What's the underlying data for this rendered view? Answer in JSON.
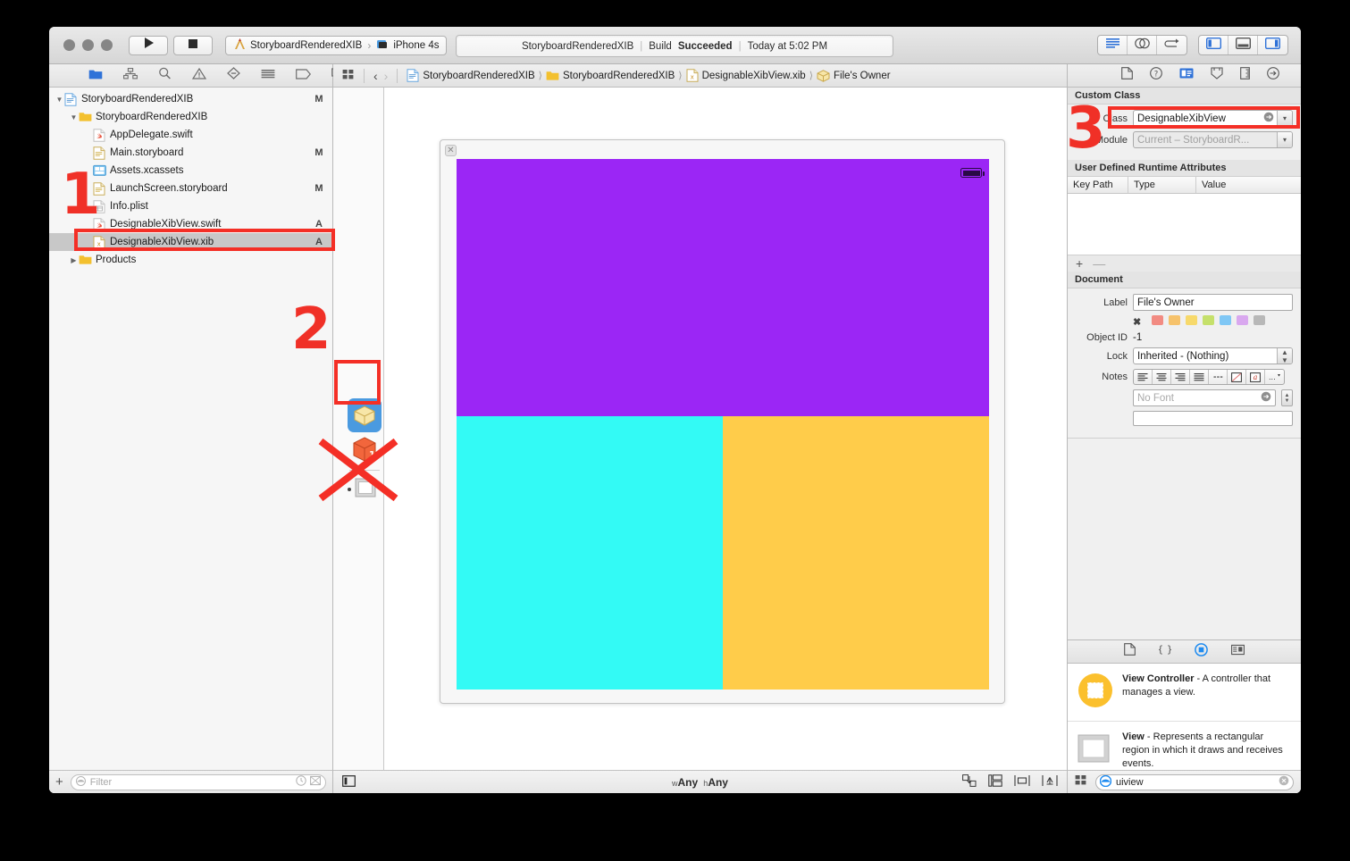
{
  "window": {
    "traffic_lights": [
      "close",
      "minimize",
      "zoom"
    ],
    "run_button": "run-icon",
    "stop_button": "stop-icon",
    "scheme": {
      "project": "StoryboardRenderedXIB",
      "destination": "iPhone 4s"
    },
    "status": {
      "project": "StoryboardRenderedXIB",
      "build_label": "Build",
      "build_result": "Succeeded",
      "time": "Today at 5:02 PM"
    },
    "editor_segment": [
      "standard-editor-icon",
      "assistant-editor-icon",
      "version-editor-icon"
    ],
    "view_segment": [
      "navigator-toggle-icon",
      "debug-area-toggle-icon",
      "utilities-toggle-icon"
    ]
  },
  "navigator": {
    "tabs": [
      "project-navigator-icon",
      "symbol-navigator-icon",
      "find-navigator-icon",
      "issue-navigator-icon",
      "test-navigator-icon",
      "debug-navigator-icon",
      "breakpoint-navigator-icon",
      "report-navigator-icon"
    ],
    "tree": [
      {
        "label": "StoryboardRenderedXIB",
        "badge": "M",
        "indent": 0,
        "icon": "project-icon",
        "disclosure": "open",
        "selected": false
      },
      {
        "label": "StoryboardRenderedXIB",
        "badge": "",
        "indent": 1,
        "icon": "folder-icon",
        "disclosure": "open",
        "selected": false
      },
      {
        "label": "AppDelegate.swift",
        "badge": "",
        "indent": 2,
        "icon": "swift-file-icon",
        "disclosure": "",
        "selected": false
      },
      {
        "label": "Main.storyboard",
        "badge": "M",
        "indent": 2,
        "icon": "storyboard-file-icon",
        "disclosure": "",
        "selected": false
      },
      {
        "label": "Assets.xcassets",
        "badge": "",
        "indent": 2,
        "icon": "assets-icon",
        "disclosure": "",
        "selected": false
      },
      {
        "label": "LaunchScreen.storyboard",
        "badge": "M",
        "indent": 2,
        "icon": "storyboard-file-icon",
        "disclosure": "",
        "selected": false
      },
      {
        "label": "Info.plist",
        "badge": "",
        "indent": 2,
        "icon": "plist-file-icon",
        "disclosure": "",
        "selected": false
      },
      {
        "label": "DesignableXibView.swift",
        "badge": "A",
        "indent": 2,
        "icon": "swift-file-icon",
        "disclosure": "",
        "selected": false
      },
      {
        "label": "DesignableXibView.xib",
        "badge": "A",
        "indent": 2,
        "icon": "xib-file-icon",
        "disclosure": "",
        "selected": true
      },
      {
        "label": "Products",
        "badge": "",
        "indent": 1,
        "icon": "folder-icon",
        "disclosure": "closed",
        "selected": false
      }
    ],
    "filter": {
      "placeholder": "Filter",
      "add_label": "+"
    }
  },
  "editor": {
    "breadcrumb": [
      {
        "label": "StoryboardRenderedXIB",
        "icon": "project-icon"
      },
      {
        "label": "StoryboardRenderedXIB",
        "icon": "folder-icon"
      },
      {
        "label": "DesignableXibView.xib",
        "icon": "xib-file-icon"
      },
      {
        "label": "File's Owner",
        "icon": "files-owner-icon"
      }
    ],
    "dock": [
      {
        "name": "files-owner-icon",
        "selected": true
      },
      {
        "name": "first-responder-icon",
        "selected": false
      },
      {
        "name": "view-object-icon",
        "selected": false,
        "crossed_out": true
      }
    ],
    "canvas": {
      "view_background_colors": {
        "top": "#9B26F5",
        "bottom_left": "#33FAF5",
        "bottom_right": "#FFCC4A"
      },
      "status_bar_item": "battery-icon"
    },
    "bottom_bar": {
      "left_icon": "show-document-outline-icon",
      "size_class": {
        "w_prefix": "w",
        "w_value": "Any",
        "h_prefix": "h",
        "h_value": "Any"
      },
      "right_icons": [
        "update-frames-icon",
        "embed-in-icon",
        "align-icon",
        "resolve-autolayout-icon"
      ]
    }
  },
  "inspector": {
    "tabs": [
      "file-inspector-icon",
      "quick-help-icon",
      "identity-inspector-icon",
      "attributes-inspector-icon",
      "size-inspector-icon",
      "connections-inspector-icon"
    ],
    "custom_class": {
      "title": "Custom Class",
      "class_label": "Class",
      "class_value": "DesignableXibView",
      "module_label": "Module",
      "module_value": "Current – StoryboardR..."
    },
    "runtime_attributes": {
      "title": "User Defined Runtime Attributes",
      "columns": [
        "Key Path",
        "Type",
        "Value"
      ],
      "rows": [],
      "add_label": "+",
      "remove_label": "—"
    },
    "document": {
      "title": "Document",
      "label_label": "Label",
      "label_value": "File's Owner",
      "label_colors": [
        "#f28b82",
        "#f6c26b",
        "#f7d96b",
        "#c5e06b",
        "#7fc7f5",
        "#d9a8ef",
        "#b8b8b8"
      ],
      "object_id_label": "Object ID",
      "object_id_value": "-1",
      "lock_label": "Lock",
      "lock_value": "Inherited - (Nothing)",
      "notes_label": "Notes",
      "notes_buttons": [
        "align-left-icon",
        "align-center-icon",
        "align-right-icon",
        "align-justify-icon",
        "dash-icon",
        "color-icon",
        "text-style-icon",
        "more-icon"
      ],
      "font_value": "No Font",
      "notes_text": ""
    }
  },
  "library": {
    "tabs": [
      "file-template-library-icon",
      "code-snippet-library-icon",
      "object-library-icon",
      "media-library-icon"
    ],
    "items": [
      {
        "title": "View Controller",
        "description": " - A controller that manages a view.",
        "icon": "view-controller-icon"
      },
      {
        "title": "View",
        "description": " - Represents a rectangular region in which it draws and receives events.",
        "icon": "view-icon"
      }
    ],
    "filter": {
      "value": "uiview",
      "clear_label": "clear-icon"
    }
  },
  "annotations": [
    {
      "number": "1",
      "target": "navigator-file-list"
    },
    {
      "number": "2",
      "target": "dock-files-owner"
    },
    {
      "number": "3",
      "target": "inspector-custom-class"
    }
  ],
  "accents": {
    "annotation_red": "#f42f26",
    "selection_blue": "#1e8bf0"
  }
}
